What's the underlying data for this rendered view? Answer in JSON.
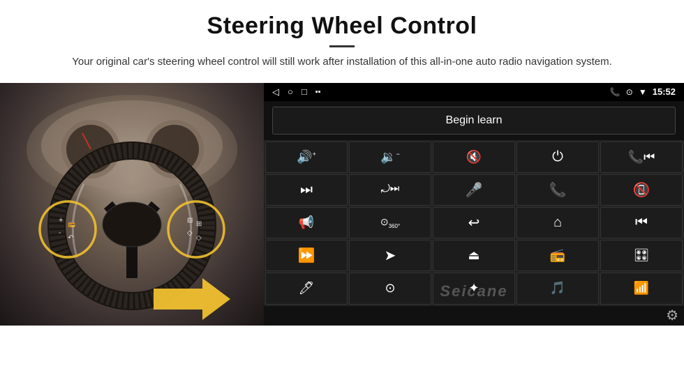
{
  "header": {
    "title": "Steering Wheel Control",
    "subtitle": "Your original car's steering wheel control will still work after installation of this all-in-one auto radio navigation system.",
    "divider": true
  },
  "status_bar": {
    "time": "15:52",
    "icons_left": [
      "back-arrow",
      "home-circle",
      "square-recent"
    ],
    "icons_right": [
      "phone-icon",
      "location-icon",
      "wifi-icon",
      "battery-icon"
    ]
  },
  "begin_learn": {
    "label": "Begin learn"
  },
  "control_grid": {
    "rows": [
      [
        "vol-up",
        "vol-down",
        "vol-mute",
        "power",
        "prev-track"
      ],
      [
        "skip-next",
        "forward-back",
        "mic",
        "phone",
        "hang-up"
      ],
      [
        "speaker",
        "360-cam",
        "back",
        "home",
        "prev-chapter"
      ],
      [
        "fast-forward",
        "navigate",
        "eject",
        "radio",
        "equalizer"
      ],
      [
        "mic2",
        "settings-dot",
        "bluetooth",
        "music",
        "waveform"
      ]
    ]
  },
  "watermark": {
    "text": "Seicane"
  },
  "settings": {
    "icon": "gear"
  }
}
